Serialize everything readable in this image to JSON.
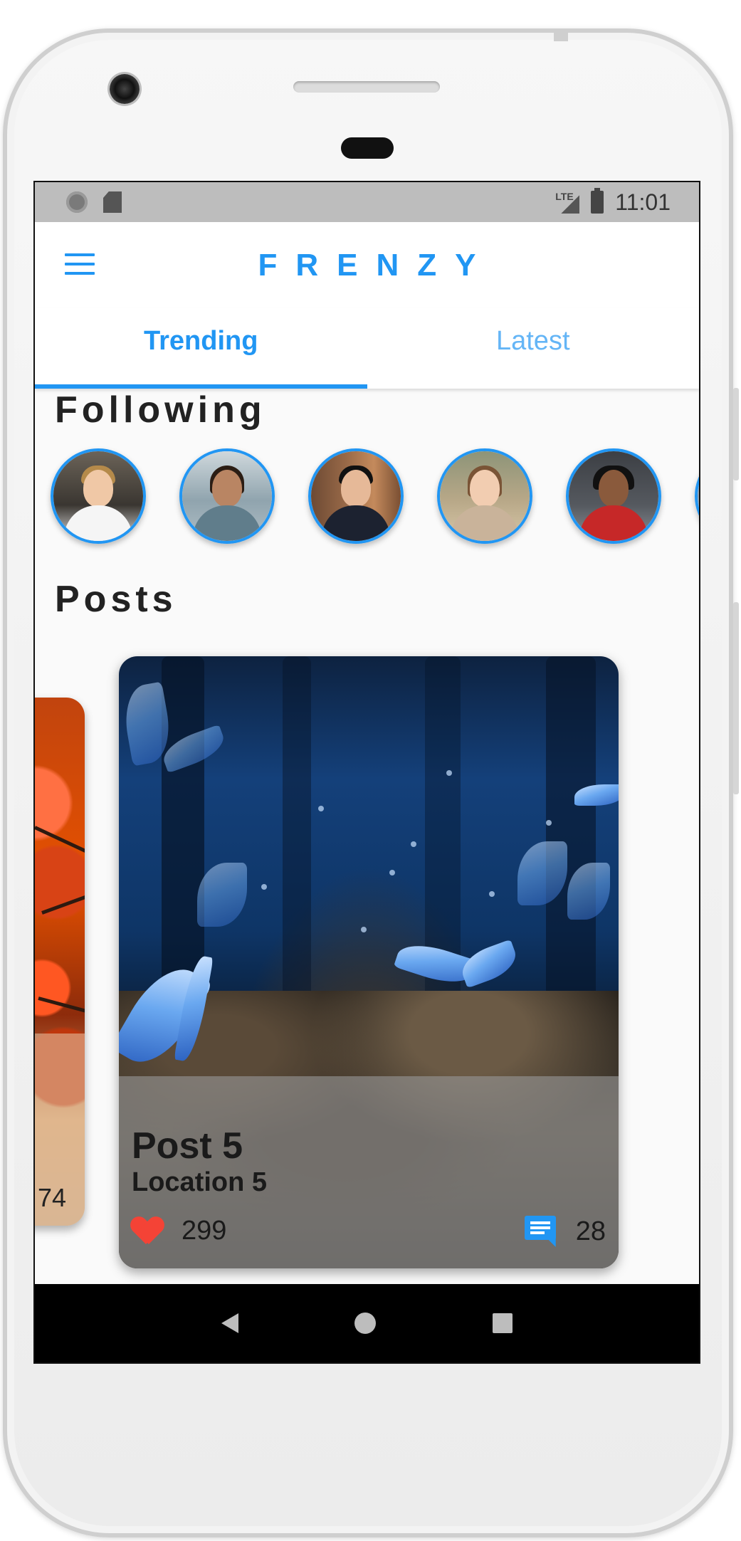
{
  "status_bar": {
    "network": "LTE",
    "time": "11:01"
  },
  "app_bar": {
    "title": "FRENZY",
    "menu_icon": "hamburger-menu-icon"
  },
  "tabs": [
    {
      "label": "Trending",
      "active": true
    },
    {
      "label": "Latest",
      "active": false
    }
  ],
  "following": {
    "title": "Following",
    "avatars": [
      {
        "name": "avatar-1"
      },
      {
        "name": "avatar-2"
      },
      {
        "name": "avatar-3"
      },
      {
        "name": "avatar-4"
      },
      {
        "name": "avatar-5"
      }
    ]
  },
  "posts": {
    "title": "Posts",
    "items": [
      {
        "likes_partial": "74"
      },
      {
        "title": "Post 5",
        "location": "Location 5",
        "likes": "299",
        "comments": "28"
      }
    ]
  },
  "colors": {
    "accent": "#2196f3",
    "like": "#f44336"
  },
  "nav": {
    "back_icon": "back-triangle-icon",
    "home_icon": "home-circle-icon",
    "recents_icon": "recents-square-icon"
  }
}
